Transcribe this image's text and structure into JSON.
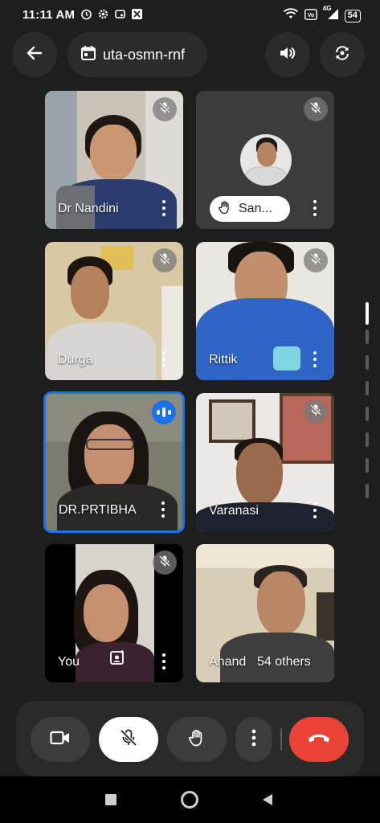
{
  "status": {
    "time": "11:11 AM",
    "battery": "54",
    "net_label": "4G"
  },
  "header": {
    "meeting_code": "uta-osmn-rnf"
  },
  "participants": [
    {
      "name": "Dr Nandini",
      "muted": true
    },
    {
      "name": "San...",
      "muted": true,
      "hand_raised": true
    },
    {
      "name": "Durga",
      "muted": true
    },
    {
      "name": "Rittik",
      "muted": true
    },
    {
      "name": "DR.PRTIBHA",
      "muted": false,
      "speaking": true
    },
    {
      "name": "Varanasi",
      "muted": true
    },
    {
      "name": "You",
      "muted": true
    },
    {
      "name": "Anand",
      "muted": false
    }
  ],
  "others_label": "54 others",
  "colors": {
    "accent": "#1a73e8",
    "end_call": "#ea4335",
    "background": "#1e1e1e"
  },
  "icons": {
    "back": "arrow-left-icon",
    "calendar": "calendar-icon",
    "speaker": "speaker-icon",
    "switch_camera": "switch-camera-icon",
    "camera": "video-camera-icon",
    "mic_off": "mic-off-icon",
    "hand": "raise-hand-icon",
    "more": "more-vert-icon",
    "end_call": "end-call-icon"
  }
}
